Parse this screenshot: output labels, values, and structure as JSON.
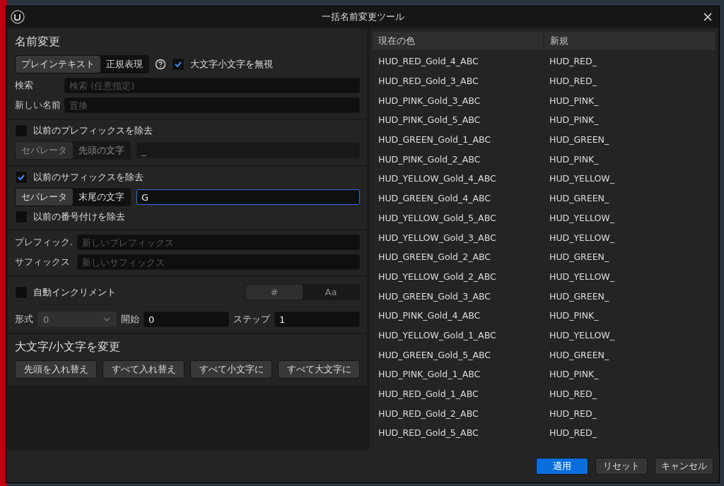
{
  "window": {
    "title": "一括名前変更ツール"
  },
  "rename": {
    "title": "名前変更",
    "modes": [
      {
        "label": "プレインテキスト",
        "selected": true
      },
      {
        "label": "正規表現",
        "selected": false
      }
    ],
    "ignore_case": {
      "label": "大文字小文字を無視",
      "checked": true
    },
    "fields": [
      {
        "label": "検索",
        "placeholder": "検索 (任意指定)"
      },
      {
        "label": "新しい名前",
        "placeholder": "置換"
      }
    ]
  },
  "remove_prefix": {
    "checkbox": {
      "label": "以前のプレフィックスを除去",
      "checked": false
    },
    "disabled": true,
    "modes": [
      {
        "label": "セパレータ",
        "selected": true
      },
      {
        "label": "先頭の文字",
        "selected": false
      }
    ],
    "field": {
      "value": "_",
      "focused": false
    }
  },
  "remove_suffix": {
    "checkbox": {
      "label": "以前のサフィックスを除去",
      "checked": true
    },
    "disabled": false,
    "modes": [
      {
        "label": "セパレータ",
        "selected": true
      },
      {
        "label": "末尾の文字",
        "selected": false
      }
    ],
    "field": {
      "value": "G",
      "focused": true
    },
    "numbering": {
      "label": "以前の番号付けを除去",
      "checked": false
    }
  },
  "add": {
    "fields": [
      {
        "label": "プレフィック.",
        "placeholder": "新しいプレフィックス"
      },
      {
        "label": "サフィックス",
        "placeholder": "新しいサフィックス"
      }
    ]
  },
  "auto_increment": {
    "checkbox": {
      "label": "自動インクリメント",
      "checked": false
    },
    "disabled": true,
    "modes": [
      {
        "label": "#",
        "selected": true
      },
      {
        "label": "Aa",
        "selected": false
      }
    ],
    "format": {
      "label": "形式",
      "value": "0"
    },
    "start": {
      "label": "開始",
      "value": "0"
    },
    "step": {
      "label": "ステップ",
      "value": "1"
    }
  },
  "case": {
    "title": "大文字/小文字を変更",
    "buttons": [
      "先頭を入れ替え",
      "すべて入れ替え",
      "すべて小文字に",
      "すべて大文字に"
    ]
  },
  "table": {
    "columns": [
      "現在の色",
      "新規"
    ],
    "rows": [
      [
        "HUD_RED_Gold_4_ABC",
        "HUD_RED_"
      ],
      [
        "HUD_RED_Gold_3_ABC",
        "HUD_RED_"
      ],
      [
        "HUD_PINK_Gold_3_ABC",
        "HUD_PINK_"
      ],
      [
        "HUD_PINK_Gold_5_ABC",
        "HUD_PINK_"
      ],
      [
        "HUD_GREEN_Gold_1_ABC",
        "HUD_GREEN_"
      ],
      [
        "HUD_PINK_Gold_2_ABC",
        "HUD_PINK_"
      ],
      [
        "HUD_YELLOW_Gold_4_ABC",
        "HUD_YELLOW_"
      ],
      [
        "HUD_GREEN_Gold_4_ABC",
        "HUD_GREEN_"
      ],
      [
        "HUD_YELLOW_Gold_5_ABC",
        "HUD_YELLOW_"
      ],
      [
        "HUD_YELLOW_Gold_3_ABC",
        "HUD_YELLOW_"
      ],
      [
        "HUD_GREEN_Gold_2_ABC",
        "HUD_GREEN_"
      ],
      [
        "HUD_YELLOW_Gold_2_ABC",
        "HUD_YELLOW_"
      ],
      [
        "HUD_GREEN_Gold_3_ABC",
        "HUD_GREEN_"
      ],
      [
        "HUD_PINK_Gold_4_ABC",
        "HUD_PINK_"
      ],
      [
        "HUD_YELLOW_Gold_1_ABC",
        "HUD_YELLOW_"
      ],
      [
        "HUD_GREEN_Gold_5_ABC",
        "HUD_GREEN_"
      ],
      [
        "HUD_PINK_Gold_1_ABC",
        "HUD_PINK_"
      ],
      [
        "HUD_RED_Gold_1_ABC",
        "HUD_RED_"
      ],
      [
        "HUD_RED_Gold_2_ABC",
        "HUD_RED_"
      ],
      [
        "HUD_RED_Gold_5_ABC",
        "HUD_RED_"
      ]
    ]
  },
  "footer": {
    "buttons": [
      {
        "label": "適用",
        "kind": "primary"
      },
      {
        "label": "リセット",
        "kind": "normal"
      },
      {
        "label": "キャンセル",
        "kind": "normal"
      }
    ]
  }
}
